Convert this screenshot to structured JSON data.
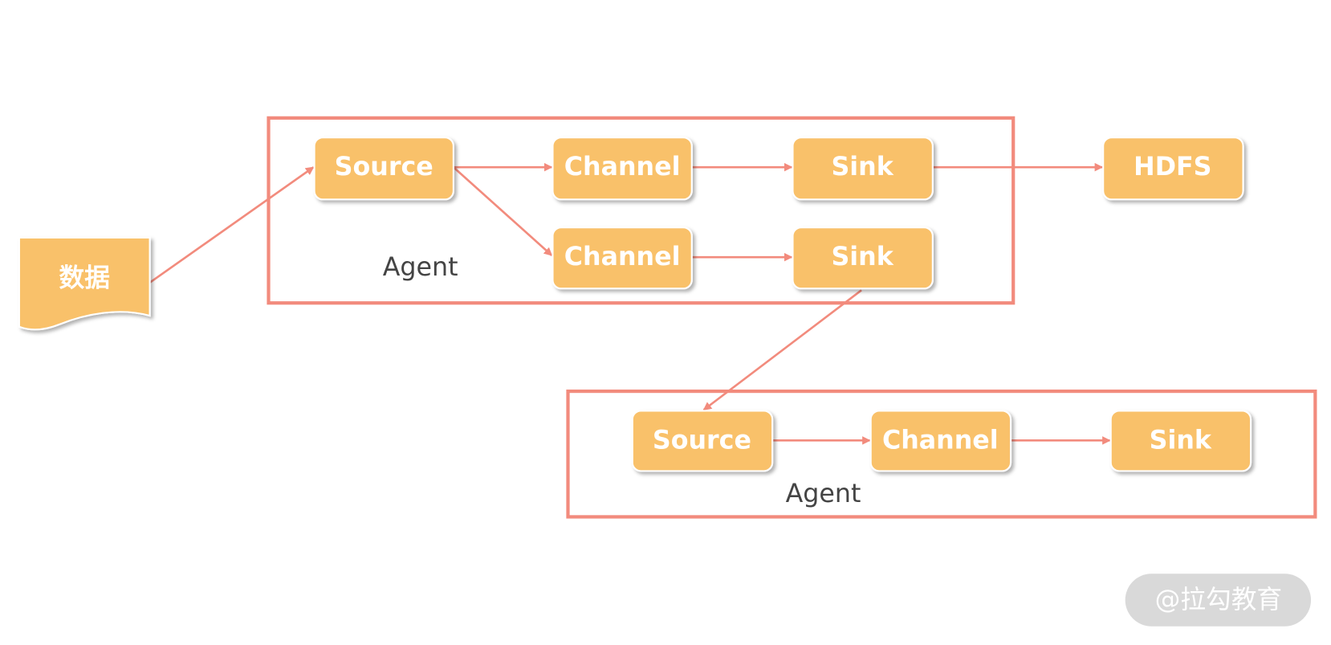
{
  "colors": {
    "node_fill": "#F9C16B",
    "border_and_arrows": "#F28B7D"
  },
  "data_node": {
    "label": "数据"
  },
  "agent1": {
    "label": "Agent",
    "source": "Source",
    "channel1": "Channel",
    "sink1": "Sink",
    "channel2": "Channel",
    "sink2": "Sink"
  },
  "hdfs": {
    "label": "HDFS"
  },
  "agent2": {
    "label": "Agent",
    "source": "Source",
    "channel": "Channel",
    "sink": "Sink"
  },
  "watermark": {
    "text": "@拉勾教育"
  }
}
